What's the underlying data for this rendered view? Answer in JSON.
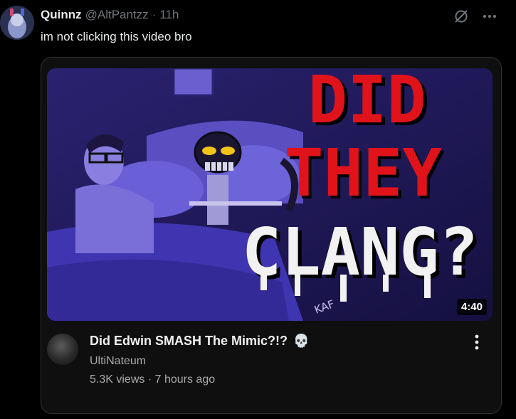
{
  "post": {
    "display_name": "Quinnz",
    "handle": "@AltPantzz",
    "separator": "·",
    "time": "11h",
    "text": "im not clicking this video bro"
  },
  "icons": {
    "grok": "grok-icon",
    "more": "more-horizontal-icon",
    "video_more": "more-vertical-icon"
  },
  "video": {
    "thumbnail_text": [
      "DID",
      "THEY",
      "CLANG?"
    ],
    "signature": "KAF",
    "duration": "4:40",
    "title": "Did Edwin SMASH The Mimic?!?",
    "title_emoji": "💀",
    "channel": "UltiNateum",
    "views": "5.3K views",
    "stats_separator": "·",
    "age": "7 hours ago"
  },
  "colors": {
    "background": "#000000",
    "thumb_red": "#e0131b",
    "thumb_white": "#f2f2f2",
    "scene_purple": "#3a2f9c"
  }
}
